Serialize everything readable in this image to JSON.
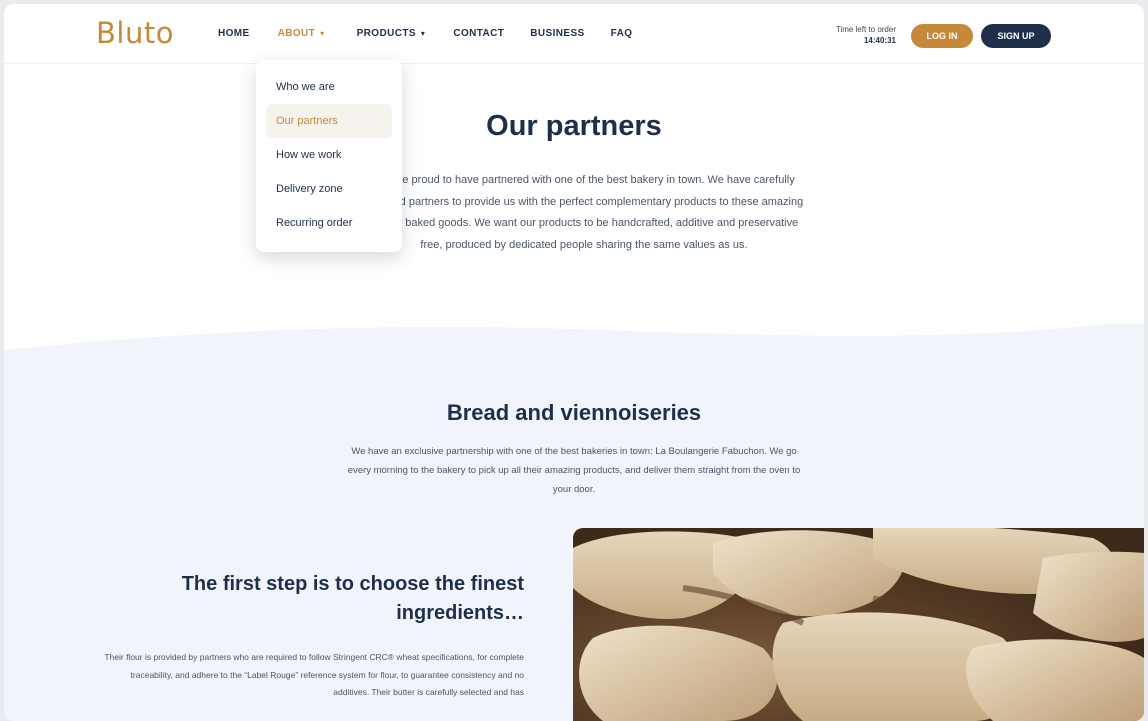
{
  "logo": "Bluto",
  "nav": {
    "items": [
      {
        "label": "HOME"
      },
      {
        "label": "ABOUT",
        "caret": "▾"
      },
      {
        "label": "PRODUCTS",
        "caret": "▾"
      },
      {
        "label": "CONTACT"
      },
      {
        "label": "BUSINESS"
      },
      {
        "label": "FAQ"
      }
    ]
  },
  "header": {
    "time_line1": "Time left to order",
    "time_line2": "14:40:31",
    "login": "LOG IN",
    "signup": "SIGN UP"
  },
  "dropdown": {
    "items": [
      {
        "label": "Who we are"
      },
      {
        "label": "Our partners"
      },
      {
        "label": "How we work"
      },
      {
        "label": "Delivery zone"
      },
      {
        "label": "Recurring order"
      }
    ]
  },
  "partners": {
    "title": "Our partners",
    "text": "We are proud to have partnered with one of the best bakery in town. We have carefully selected partners to provide us with the perfect complementary products to these amazing freshly baked goods. We want our products to be handcrafted, additive and preservative free, produced by dedicated people sharing the same values as us."
  },
  "bread": {
    "title": "Bread and viennoiseries",
    "text": "We have an exclusive partnership with one of the best bakeries in town: La Boulangerie Fabuchon. We go every morning to the bakery to pick up all their amazing products, and deliver them straight from the oven to your door."
  },
  "step": {
    "title": "The first step is to choose the finest ingredients…",
    "text": "Their flour is provided by partners who are required to follow Stringent CRC® wheat specifications, for complete traceability, and adhere to the “Label Rouge” reference system for flour, to guarantee consistency and no additives. Their butter is carefully selected and has"
  },
  "colors": {
    "accent": "#c6893a",
    "navy": "#1f2f4a",
    "band": "#f1f5fb"
  }
}
